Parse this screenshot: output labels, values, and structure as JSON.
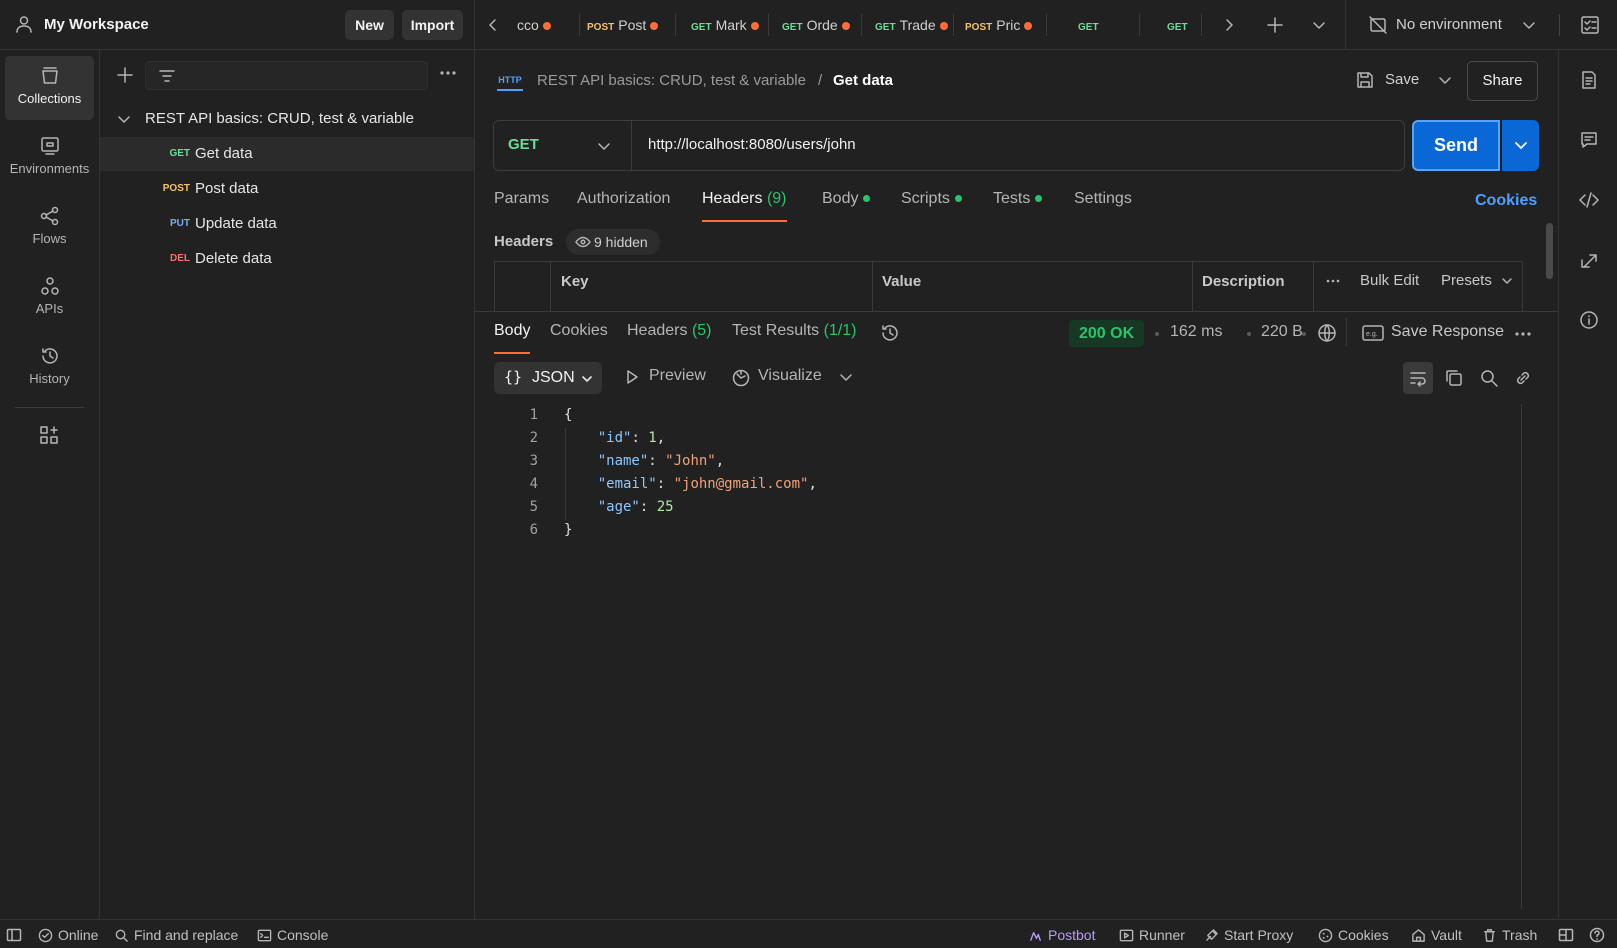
{
  "workspace": {
    "title": "My Workspace",
    "new_label": "New",
    "import_label": "Import"
  },
  "tabs": [
    {
      "method": "",
      "name": "cco",
      "dirty": true
    },
    {
      "method": "POST",
      "name": "Post",
      "dirty": true
    },
    {
      "method": "GET",
      "name": "Mark",
      "dirty": true
    },
    {
      "method": "GET",
      "name": "Orde",
      "dirty": true
    },
    {
      "method": "GET",
      "name": "Trade",
      "dirty": true
    },
    {
      "method": "POST",
      "name": "Pric",
      "dirty": true
    },
    {
      "method": "GET",
      "name": "",
      "dirty": false
    },
    {
      "method": "GET",
      "name": "",
      "dirty": false
    }
  ],
  "environment": {
    "label": "No environment"
  },
  "rail": {
    "items": [
      {
        "label": "Collections",
        "icon": "collections-icon",
        "active": true
      },
      {
        "label": "Environments",
        "icon": "environments-icon",
        "active": false
      },
      {
        "label": "Flows",
        "icon": "flows-icon",
        "active": false
      },
      {
        "label": "APIs",
        "icon": "apis-icon",
        "active": false
      },
      {
        "label": "History",
        "icon": "history-icon",
        "active": false
      }
    ]
  },
  "collection": {
    "name": "REST API basics: CRUD, test & variable",
    "requests": [
      {
        "method": "GET",
        "name": "Get data",
        "active": true
      },
      {
        "method": "POST",
        "name": "Post data",
        "active": false
      },
      {
        "method": "PUT",
        "name": "Update data",
        "active": false
      },
      {
        "method": "DEL",
        "name": "Delete data",
        "active": false
      }
    ]
  },
  "request": {
    "type_badge": "HTTP",
    "breadcrumb_parent": "REST API basics: CRUD, test & variable",
    "breadcrumb_sep": "/",
    "breadcrumb_current": "Get data",
    "save_label": "Save",
    "share_label": "Share",
    "method": "GET",
    "url": "http://localhost:8080/users/john",
    "send_label": "Send",
    "tabs": [
      {
        "label": "Params"
      },
      {
        "label": "Authorization"
      },
      {
        "label": "Headers",
        "count": "(9)"
      },
      {
        "label": "Body",
        "dot": true
      },
      {
        "label": "Scripts",
        "dot": true
      },
      {
        "label": "Tests",
        "dot": true
      },
      {
        "label": "Settings"
      }
    ],
    "cookies_label": "Cookies",
    "headers_title": "Headers",
    "hidden_label": "9 hidden",
    "columns": [
      "Key",
      "Value",
      "Description"
    ],
    "bulk_edit_label": "Bulk Edit",
    "presets_label": "Presets"
  },
  "response": {
    "tabs": [
      {
        "label": "Body"
      },
      {
        "label": "Cookies"
      },
      {
        "label": "Headers",
        "count": "(5)"
      },
      {
        "label": "Test Results",
        "count": "(1/1)"
      }
    ],
    "status": "200 OK",
    "time": "162 ms",
    "size": "220 B",
    "save_label": "Save Response",
    "format": "JSON",
    "preview_label": "Preview",
    "visualize_label": "Visualize",
    "lines": [
      {
        "num": "1",
        "text": "{"
      },
      {
        "num": "2",
        "key": "\"id\"",
        "value": "1",
        "type": "n",
        "comma": ","
      },
      {
        "num": "3",
        "key": "\"name\"",
        "value": "\"John\"",
        "type": "s",
        "comma": ","
      },
      {
        "num": "4",
        "key": "\"email\"",
        "value": "\"john@gmail.com\"",
        "type": "s",
        "comma": ","
      },
      {
        "num": "5",
        "key": "\"age\"",
        "value": "25",
        "type": "n",
        "comma": ""
      },
      {
        "num": "6",
        "text": "}"
      }
    ]
  },
  "statusbar": {
    "online": "Online",
    "find_replace": "Find and replace",
    "console": "Console",
    "postbot": "Postbot",
    "runner": "Runner",
    "proxy": "Start Proxy",
    "cookies": "Cookies",
    "vault": "Vault",
    "trash": "Trash"
  },
  "colors": {
    "accent": "#ff6c37",
    "send": "#0a68d6",
    "get": "#6bdd9a",
    "post": "#f5c36b",
    "put": "#74aef6",
    "del": "#f07178",
    "ok": "#2ac46b"
  }
}
